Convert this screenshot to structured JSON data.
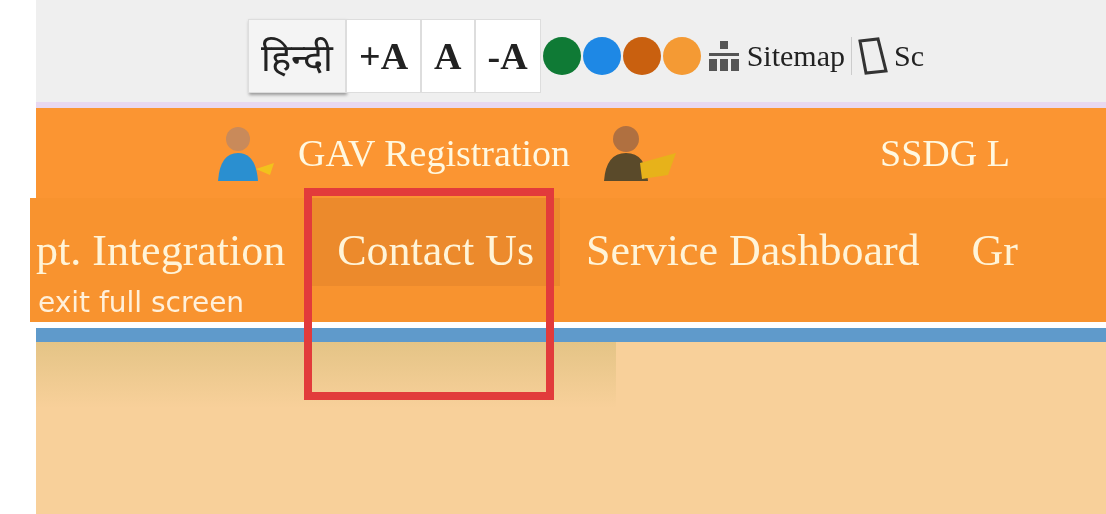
{
  "toolbar": {
    "language_button": "हिन्दी",
    "font_buttons": [
      "+A",
      "A",
      "-A"
    ],
    "theme_swatches": [
      {
        "color": "#0f7a35",
        "selected": false
      },
      {
        "color": "#1e88e5",
        "selected": false
      },
      {
        "color": "#c9600f",
        "selected": false
      },
      {
        "color": "#f49a34",
        "selected": false
      }
    ],
    "sitemap_link": "Sitemap",
    "screen_reader_link": "Sc"
  },
  "top_links": [
    {
      "label": "GAV Registration"
    },
    {
      "label": "SSDG L"
    }
  ],
  "menu": [
    {
      "label": "pt. Integration",
      "selected": false
    },
    {
      "label": "Contact Us",
      "selected": true
    },
    {
      "label": "Service Dashboard",
      "selected": false
    },
    {
      "label": "Gr",
      "selected": false
    }
  ],
  "overlay_text": "exit full screen"
}
